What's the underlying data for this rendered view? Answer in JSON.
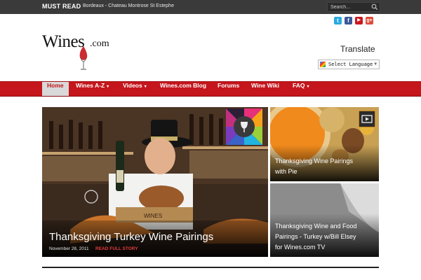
{
  "topbar": {
    "must_read": "MUST READ",
    "ticker": "Bordeaux - Chateau Montrose St Estephe",
    "search_placeholder": "Search..."
  },
  "social": [
    {
      "name": "twitter",
      "glyph": "t",
      "color": "#2aa9e0"
    },
    {
      "name": "facebook",
      "glyph": "f",
      "color": "#3b5998"
    },
    {
      "name": "youtube",
      "glyph": "▶",
      "color": "#cc181e"
    },
    {
      "name": "google-plus",
      "glyph": "g+",
      "color": "#dd4b39"
    }
  ],
  "logo": {
    "word": "Wines",
    "suffix": ".com"
  },
  "translate": {
    "title": "Translate",
    "select_value": "Select Language"
  },
  "nav": [
    {
      "label": "Home",
      "active": true,
      "dropdown": false
    },
    {
      "label": "Wines A-Z",
      "active": false,
      "dropdown": true
    },
    {
      "label": "Videos",
      "active": false,
      "dropdown": true
    },
    {
      "label": "Wines.com Blog",
      "active": false,
      "dropdown": false
    },
    {
      "label": "Forums",
      "active": false,
      "dropdown": false
    },
    {
      "label": "Wine Wiki",
      "active": false,
      "dropdown": false
    },
    {
      "label": "FAQ",
      "active": false,
      "dropdown": true
    }
  ],
  "featured": {
    "title": "Thanksgiving Turkey Wine Pairings",
    "date": "November 28, 2011",
    "read_more": "READ FULL STORY",
    "crate_text": "WINES"
  },
  "cards": [
    {
      "lines": [
        "Thanksgiving Wine Pairings",
        "with Pie"
      ]
    },
    {
      "lines": [
        "Thanksgiving Wine and Food",
        "Pairings - Turkey w/Bill Elsey",
        "for Wines.com TV"
      ]
    }
  ],
  "colors": {
    "brand_red": "#c4161c",
    "topbar": "#3a3a3a",
    "read_more": "#e43d3d"
  }
}
